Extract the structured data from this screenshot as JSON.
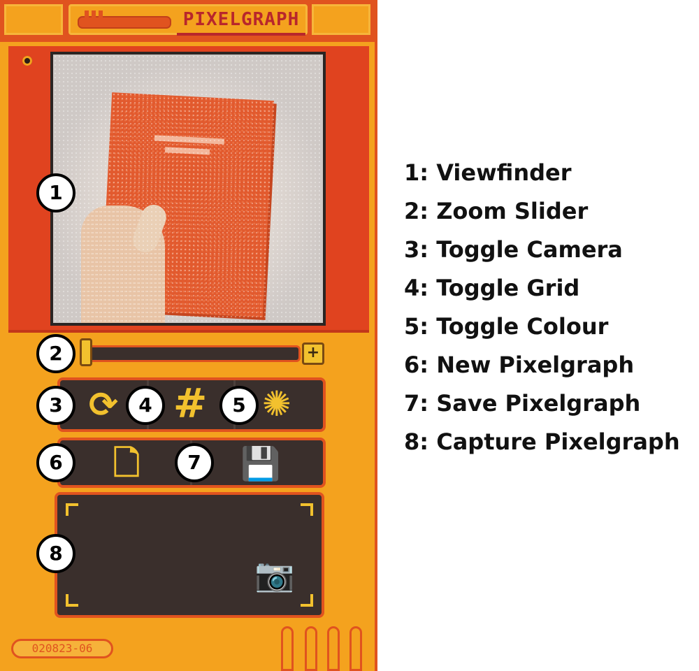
{
  "app": {
    "title": "PIXELGRAPH",
    "serial": "020823-06"
  },
  "colors": {
    "shell": "#f4a21e",
    "accent_red": "#e0431f",
    "dark_panel": "#3a2f2c",
    "icon_yellow": "#f2c12e",
    "logo_red": "#b8262c"
  },
  "viewfinder": {
    "subject": "hand-holding-red-book"
  },
  "zoom": {
    "level": 0.0,
    "plus_icon": "plus-icon",
    "plus_label": "+"
  },
  "toggles": [
    {
      "icon": "camera-switch-icon",
      "glyph": "⟳"
    },
    {
      "icon": "grid-icon",
      "glyph": "#"
    },
    {
      "icon": "colour-palette-icon",
      "glyph": "✺"
    }
  ],
  "actions": [
    {
      "icon": "new-document-icon",
      "glyph": "🗋"
    },
    {
      "icon": "save-floppy-icon",
      "glyph": "💾"
    }
  ],
  "capture": {
    "icon": "camera-capture-icon",
    "glyph": "📷"
  },
  "badges": [
    "1",
    "2",
    "3",
    "4",
    "5",
    "6",
    "7",
    "8"
  ],
  "legend": [
    "1: Viewfinder",
    "2: Zoom Slider",
    "3: Toggle Camera",
    "4: Toggle Grid",
    "5: Toggle Colour",
    "6: New Pixelgraph",
    "7: Save Pixelgraph",
    "8: Capture Pixelgraph"
  ]
}
